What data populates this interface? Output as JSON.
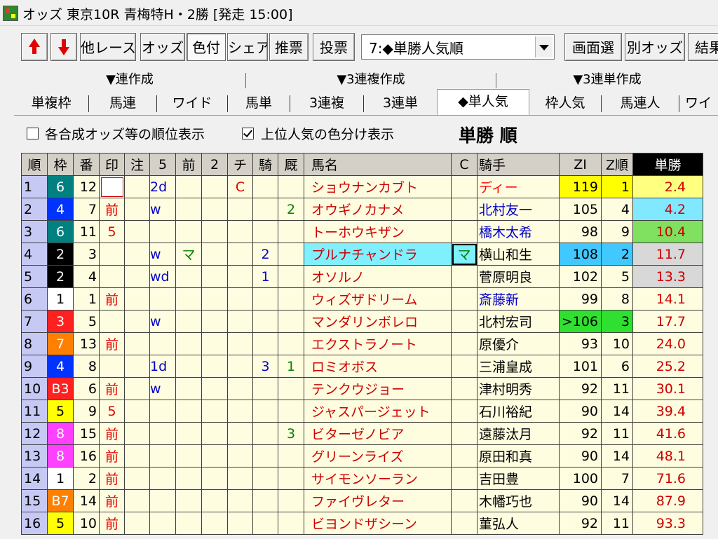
{
  "title": "オッズ 東京10R 青梅特H・2勝 [発走 15:00]",
  "toolbar": {
    "prev_race": "",
    "next_race": "",
    "buttons": [
      "他レース",
      "オッズ",
      "色付",
      "シェア",
      "推票",
      "投票"
    ],
    "select_value": "7:◆単勝人気順",
    "right_buttons": [
      "画面選",
      "別オッズ",
      "結果"
    ]
  },
  "group_tabs": [
    "▼連作成",
    "▼3連複作成",
    "▼3連単作成"
  ],
  "tabs": [
    "単複枠",
    "馬連",
    "ワイド",
    "馬単",
    "3連複",
    "3連単",
    "◆単人気",
    "枠人気",
    "馬連人",
    "ワイ"
  ],
  "options": {
    "rank_combined": "各合成オッズ等の順位表示",
    "color_popular": "上位人気の色分け表示",
    "sort_title": "単勝 順"
  },
  "headers": [
    "順",
    "枠",
    "番",
    "印",
    "注",
    "5",
    "前",
    "2",
    "チ",
    "騎",
    "厩",
    "馬名",
    "C",
    "騎手",
    "ZI",
    "Z順",
    "単勝"
  ],
  "rows": [
    {
      "rank": "1",
      "waku": "6",
      "ban": "12",
      "mark": "",
      "note": "",
      "five": "2d",
      "prev": "",
      "two": "",
      "chi": "C",
      "ki": "",
      "kyu": "",
      "name": "ショウナンカブト",
      "c": "",
      "jockey": "ディー",
      "zi": "119",
      "zrank": "1",
      "odds": "2.4"
    },
    {
      "rank": "2",
      "waku": "4",
      "ban": "7",
      "mark": "前",
      "note": "",
      "five": "w",
      "prev": "",
      "two": "",
      "chi": "",
      "ki": "",
      "kyu": "2",
      "name": "オウギノカナメ",
      "c": "",
      "jockey": "北村友一",
      "zi": "105",
      "zrank": "4",
      "odds": "4.2"
    },
    {
      "rank": "3",
      "waku": "6",
      "ban": "11",
      "mark": "5",
      "note": "",
      "five": "",
      "prev": "",
      "two": "",
      "chi": "",
      "ki": "",
      "kyu": "",
      "name": "トーホウキザン",
      "c": "",
      "jockey": "橋木太希",
      "zi": "98",
      "zrank": "9",
      "odds": "10.4"
    },
    {
      "rank": "4",
      "waku": "2",
      "ban": "3",
      "mark": "",
      "note": "",
      "five": "w",
      "prev": "マ",
      "two": "",
      "chi": "",
      "ki": "2",
      "kyu": "",
      "name": "プルナチャンドラ",
      "c": "マ",
      "jockey": "横山和生",
      "zi": "108",
      "zrank": "2",
      "odds": "11.7"
    },
    {
      "rank": "5",
      "waku": "2",
      "ban": "4",
      "mark": "",
      "note": "",
      "five": "wd",
      "prev": "",
      "two": "",
      "chi": "",
      "ki": "1",
      "kyu": "",
      "name": "オソルノ",
      "c": "",
      "jockey": "菅原明良",
      "zi": "102",
      "zrank": "5",
      "odds": "13.3"
    },
    {
      "rank": "6",
      "waku": "1",
      "ban": "1",
      "mark": "前",
      "note": "",
      "five": "",
      "prev": "",
      "two": "",
      "chi": "",
      "ki": "",
      "kyu": "",
      "name": "ウィズザドリーム",
      "c": "",
      "jockey": "斎藤新",
      "zi": "99",
      "zrank": "8",
      "odds": "14.1"
    },
    {
      "rank": "7",
      "waku": "3",
      "ban": "5",
      "mark": "",
      "note": "",
      "five": "w",
      "prev": "",
      "two": "",
      "chi": "",
      "ki": "",
      "kyu": "",
      "name": "マンダリンボレロ",
      "c": "",
      "jockey": "北村宏司",
      "zi": ">106",
      "zrank": "3",
      "odds": "17.7"
    },
    {
      "rank": "8",
      "waku": "7",
      "ban": "13",
      "mark": "前",
      "note": "",
      "five": "",
      "prev": "",
      "two": "",
      "chi": "",
      "ki": "",
      "kyu": "",
      "name": "エクストラノート",
      "c": "",
      "jockey": "原優介",
      "zi": "93",
      "zrank": "10",
      "odds": "24.0"
    },
    {
      "rank": "9",
      "waku": "4",
      "ban": "8",
      "mark": "",
      "note": "",
      "five": "1d",
      "prev": "",
      "two": "",
      "chi": "",
      "ki": "3",
      "kyu": "1",
      "name": "ロミオボス",
      "c": "",
      "jockey": "三浦皇成",
      "zi": "101",
      "zrank": "6",
      "odds": "25.2"
    },
    {
      "rank": "10",
      "waku": "B3",
      "ban": "6",
      "mark": "前",
      "note": "",
      "five": "w",
      "prev": "",
      "two": "",
      "chi": "",
      "ki": "",
      "kyu": "",
      "name": "テンクウジョー",
      "c": "",
      "jockey": "津村明秀",
      "zi": "92",
      "zrank": "11",
      "odds": "30.1"
    },
    {
      "rank": "11",
      "waku": "5",
      "ban": "9",
      "mark": "5",
      "note": "",
      "five": "",
      "prev": "",
      "two": "",
      "chi": "",
      "ki": "",
      "kyu": "",
      "name": "ジャスパージェット",
      "c": "",
      "jockey": "石川裕紀",
      "zi": "90",
      "zrank": "14",
      "odds": "39.4"
    },
    {
      "rank": "12",
      "waku": "8",
      "ban": "15",
      "mark": "前",
      "note": "",
      "five": "",
      "prev": "",
      "two": "",
      "chi": "",
      "ki": "",
      "kyu": "3",
      "name": "ビターゼノビア",
      "c": "",
      "jockey": "遠藤汰月",
      "zi": "92",
      "zrank": "11",
      "odds": "41.6"
    },
    {
      "rank": "13",
      "waku": "8",
      "ban": "16",
      "mark": "前",
      "note": "",
      "five": "",
      "prev": "",
      "two": "",
      "chi": "",
      "ki": "",
      "kyu": "",
      "name": "グリーンライズ",
      "c": "",
      "jockey": "原田和真",
      "zi": "90",
      "zrank": "14",
      "odds": "48.1"
    },
    {
      "rank": "14",
      "waku": "1",
      "ban": "2",
      "mark": "前",
      "note": "",
      "five": "",
      "prev": "",
      "two": "",
      "chi": "",
      "ki": "",
      "kyu": "",
      "name": "サイモンソーラン",
      "c": "",
      "jockey": "吉田豊",
      "zi": "100",
      "zrank": "7",
      "odds": "71.6"
    },
    {
      "rank": "15",
      "waku": "B7",
      "ban": "14",
      "mark": "前",
      "note": "",
      "five": "",
      "prev": "",
      "two": "",
      "chi": "",
      "ki": "",
      "kyu": "",
      "name": "ファイヴレター",
      "c": "",
      "jockey": "木幡巧也",
      "zi": "90",
      "zrank": "14",
      "odds": "87.9"
    },
    {
      "rank": "16",
      "waku": "5",
      "ban": "10",
      "mark": "前",
      "note": "",
      "five": "",
      "prev": "",
      "two": "",
      "chi": "",
      "ki": "",
      "kyu": "",
      "name": "ビヨンドザシーン",
      "c": "",
      "jockey": "菫弘人",
      "zi": "92",
      "zrank": "11",
      "odds": "93.3"
    }
  ],
  "colors": {
    "waku": {
      "1": "#ffffff",
      "2": "#000000",
      "3": "#ff2020",
      "4": "#0033ff",
      "5": "#ffff00",
      "6": "#008080",
      "7": "#ff8000",
      "8": "#ff40ff",
      "B3": "#ff2020",
      "B7": "#ff8000"
    },
    "waku_text": {
      "1": "#000000",
      "2": "#ffffff",
      "3": "#ffffff",
      "4": "#ffffff",
      "5": "#000000",
      "6": "#ffffff",
      "7": "#ffffff",
      "8": "#ffffff",
      "B3": "#ffffff",
      "B7": "#ffffff"
    },
    "odds_bg": {
      "1": "#ffff80",
      "2": "#80e8ff",
      "3": "#80e060",
      "4": "#d8d8d8",
      "5": "#d8d8d8"
    },
    "zi_bg": {
      "1": "#ffff00",
      "2": "#40c8ff",
      "3": "#30e030"
    },
    "jockey_blue": [
      "北村友一",
      "橋木太希",
      "斎藤新"
    ],
    "jockey_red": [
      "ディー"
    ]
  }
}
